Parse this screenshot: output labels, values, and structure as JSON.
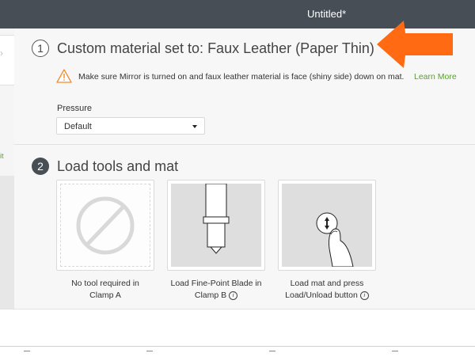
{
  "window": {
    "title": "Untitled*"
  },
  "sidebar": {
    "chevron": "›",
    "edit_label": "it"
  },
  "step1": {
    "number": "1",
    "title": "Custom material set to: Faux Leather (Paper Thin)",
    "warning_icon": "warning-triangle-icon",
    "warning_text": "Make sure Mirror is turned on and faux leather material is face (shiny side) down on mat.",
    "learn_more": "Learn More",
    "pressure_label": "Pressure",
    "pressure_value": "Default"
  },
  "step2": {
    "number": "2",
    "title": "Load tools and mat",
    "cards": [
      {
        "icon": "no-tool-icon",
        "caption_line1": "No tool required in",
        "caption_line2": "Clamp A"
      },
      {
        "icon": "fine-point-blade-icon",
        "caption_line1": "Load Fine-Point Blade in",
        "caption_line2": "Clamp B"
      },
      {
        "icon": "load-unload-button-icon",
        "caption_line1": "Load mat and press",
        "caption_line2": "Load/Unload button"
      }
    ],
    "info_glyph": "i"
  },
  "colors": {
    "accent_green": "#5aa02c",
    "topbar": "#474e55",
    "arrow_orange": "#ff6a13",
    "warning_orange": "#f08c2c"
  }
}
